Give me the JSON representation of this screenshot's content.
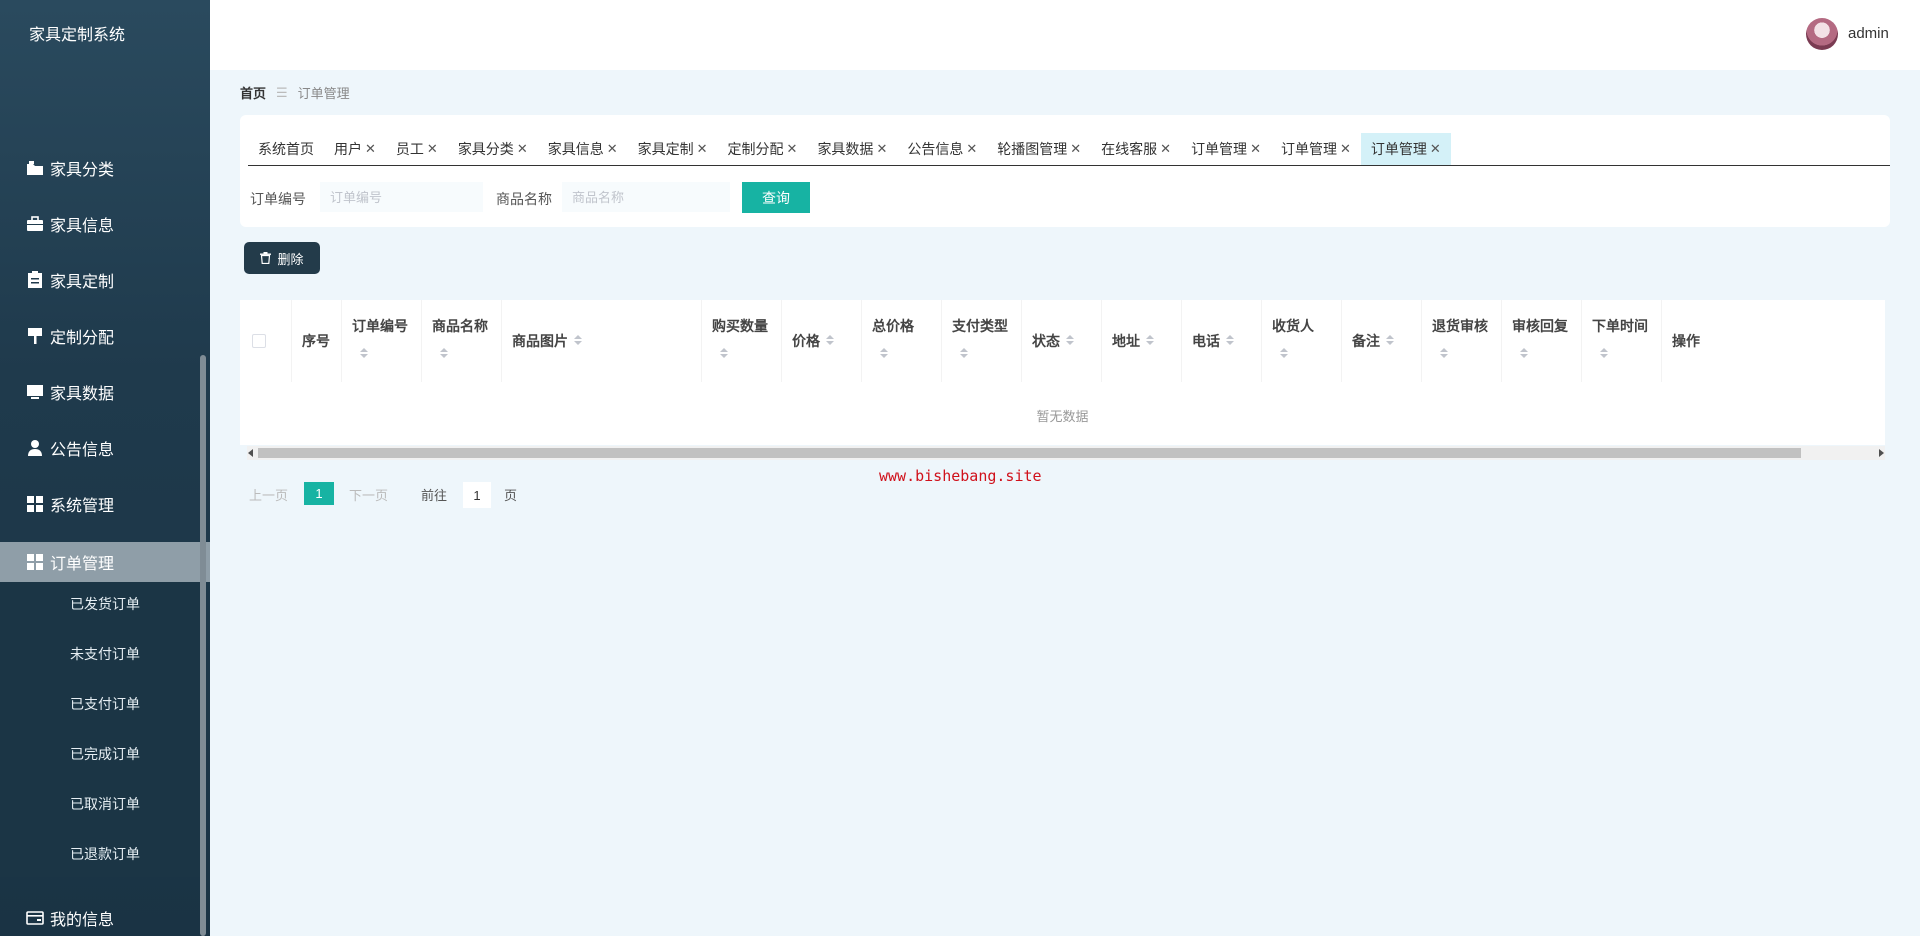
{
  "app": {
    "title": "家具定制系统"
  },
  "sidebar": {
    "items": [
      {
        "label": "家具分类",
        "icon": "folder-icon"
      },
      {
        "label": "家具信息",
        "icon": "briefcase-icon"
      },
      {
        "label": "家具定制",
        "icon": "clipboard-icon"
      },
      {
        "label": "定制分配",
        "icon": "signpost-icon"
      },
      {
        "label": "家具数据",
        "icon": "monitor-icon"
      },
      {
        "label": "公告信息",
        "icon": "user-icon"
      },
      {
        "label": "系统管理",
        "icon": "grid-icon"
      },
      {
        "label": "订单管理",
        "icon": "grid-icon"
      }
    ],
    "sub_items": [
      "已发货订单",
      "未支付订单",
      "已支付订单",
      "已完成订单",
      "已取消订单",
      "已退款订单"
    ],
    "profile": {
      "label": "我的信息",
      "icon": "wallet-icon"
    }
  },
  "header": {
    "username": "admin"
  },
  "breadcrumb": {
    "home": "首页",
    "current": "订单管理"
  },
  "tabs": [
    {
      "label": "系统首页",
      "closable": false
    },
    {
      "label": "用户",
      "closable": true
    },
    {
      "label": "员工",
      "closable": true
    },
    {
      "label": "家具分类",
      "closable": true
    },
    {
      "label": "家具信息",
      "closable": true
    },
    {
      "label": "家具定制",
      "closable": true
    },
    {
      "label": "定制分配",
      "closable": true
    },
    {
      "label": "家具数据",
      "closable": true
    },
    {
      "label": "公告信息",
      "closable": true
    },
    {
      "label": "轮播图管理",
      "closable": true
    },
    {
      "label": "在线客服",
      "closable": true
    },
    {
      "label": "订单管理",
      "closable": true
    },
    {
      "label": "订单管理",
      "closable": true
    },
    {
      "label": "订单管理",
      "closable": true,
      "active": true
    }
  ],
  "search": {
    "order_no_label": "订单编号",
    "order_no_placeholder": "订单编号",
    "product_label": "商品名称",
    "product_placeholder": "商品名称",
    "query_label": "查询"
  },
  "toolbar": {
    "delete_label": "删除"
  },
  "table": {
    "columns": [
      {
        "label": "序号",
        "sortable": false
      },
      {
        "label": "订单编号",
        "sortable": true
      },
      {
        "label": "商品名称",
        "sortable": true
      },
      {
        "label": "商品图片",
        "sortable": true
      },
      {
        "label": "购买数量",
        "sortable": true
      },
      {
        "label": "价格",
        "sortable": true
      },
      {
        "label": "总价格",
        "sortable": true
      },
      {
        "label": "支付类型",
        "sortable": true
      },
      {
        "label": "状态",
        "sortable": true
      },
      {
        "label": "地址",
        "sortable": true
      },
      {
        "label": "电话",
        "sortable": true
      },
      {
        "label": "收货人",
        "sortable": true
      },
      {
        "label": "备注",
        "sortable": true
      },
      {
        "label": "退货审核",
        "sortable": true
      },
      {
        "label": "审核回复",
        "sortable": true
      },
      {
        "label": "下单时间",
        "sortable": true
      },
      {
        "label": "操作",
        "sortable": false
      }
    ],
    "empty_text": "暂无数据"
  },
  "watermark": "www.bishebang.site",
  "pagination": {
    "prev": "上一页",
    "current": "1",
    "next": "下一页",
    "goto": "前往",
    "goto_value": "1",
    "unit": "页"
  },
  "colors": {
    "sidebar": "#1f3a4c",
    "accent": "#17b3a3",
    "active_tab": "#d4f1f8",
    "delete_button": "#233b4a"
  }
}
